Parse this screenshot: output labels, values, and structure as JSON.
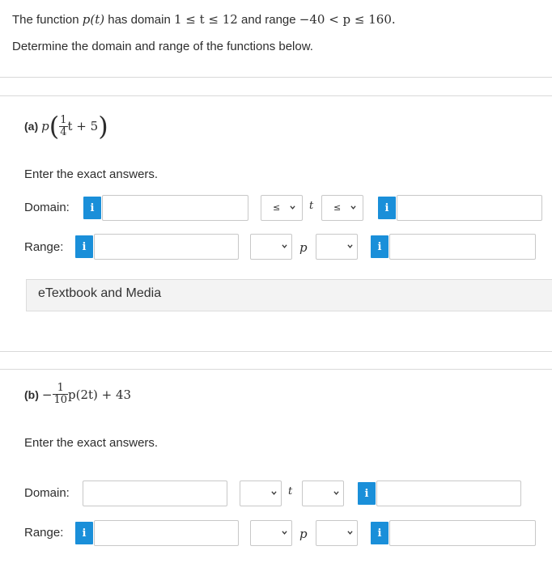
{
  "intro": {
    "line1_prefix": "The function",
    "func": "p(t)",
    "line1_mid1": "has domain",
    "domain_expr": "1 ≤ t ≤ 12",
    "line1_mid2": "and range",
    "range_expr": "−40 < p ≤ 160.",
    "line2": "Determine the domain and range of the functions below."
  },
  "part_a": {
    "label": "(a)",
    "expr_p": "p",
    "frac_num": "1",
    "frac_den": "4",
    "expr_tail": "t + 5",
    "instructions": "Enter the exact answers.",
    "domain_label": "Domain:",
    "range_label": "Range:",
    "domain_sel1": "≤",
    "domain_sel2": "≤",
    "var_t": "t",
    "var_p": "p",
    "etextbook": "eTextbook and Media"
  },
  "part_b": {
    "label": "(b)",
    "frac_num": "1",
    "frac_den": "10",
    "expr_tail": "p(2t) + 43",
    "minus": "−",
    "instructions": "Enter the exact answers.",
    "domain_label": "Domain:",
    "range_label": "Range:",
    "var_t": "t",
    "var_p": "p"
  },
  "icons": {
    "info": "i"
  },
  "colors": {
    "info_button": "#1a8fd9",
    "border": "#c8c8c8"
  }
}
